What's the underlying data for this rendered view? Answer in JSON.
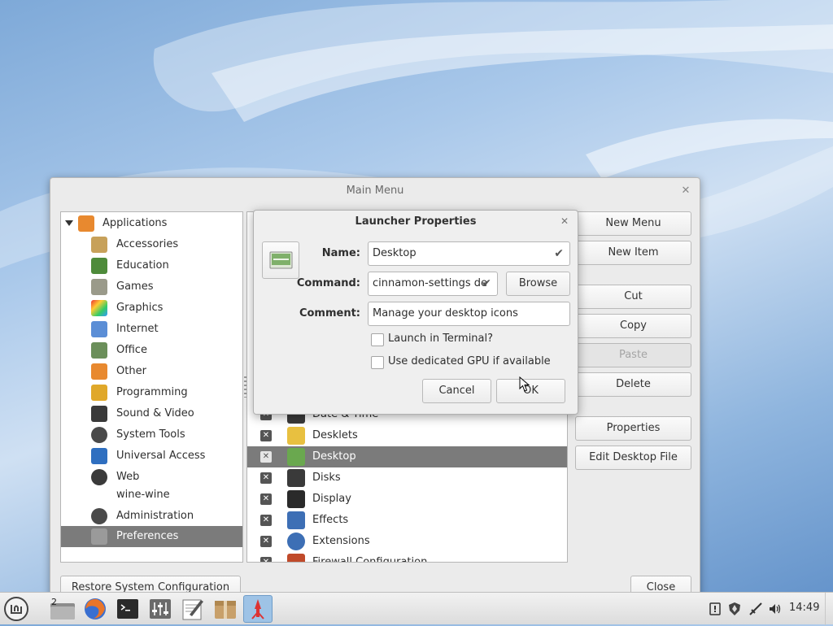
{
  "main_window": {
    "title": "Main Menu",
    "categories": {
      "root": "Applications",
      "items": [
        {
          "label": "Accessories",
          "color": "#c7a15a"
        },
        {
          "label": "Education",
          "color": "#4e8b3a"
        },
        {
          "label": "Games",
          "color": "#9a9a8a"
        },
        {
          "label": "Graphics",
          "color": "#d4477b"
        },
        {
          "label": "Internet",
          "color": "#5b8ed6"
        },
        {
          "label": "Office",
          "color": "#6b8f5a"
        },
        {
          "label": "Other",
          "color": "#e8892f"
        },
        {
          "label": "Programming",
          "color": "#e0a82a"
        },
        {
          "label": "Sound & Video",
          "color": "#3a3a3a"
        },
        {
          "label": "System Tools",
          "color": "#4a4a4a"
        },
        {
          "label": "Universal Access",
          "color": "#2f6fc0"
        },
        {
          "label": "Web",
          "color": "#3a3a3a"
        },
        {
          "label": "wine-wine",
          "color": ""
        },
        {
          "label": "Administration",
          "color": "#4a4a4a"
        },
        {
          "label": "Preferences",
          "color": "#7a7a7a"
        }
      ],
      "selected": "Preferences"
    },
    "items": [
      {
        "label": "Date & Time",
        "checked": true,
        "color": "#3a3a3a"
      },
      {
        "label": "Desklets",
        "checked": true,
        "color": "#e8c040"
      },
      {
        "label": "Desktop",
        "checked": true,
        "color": "#6aa84f"
      },
      {
        "label": "Disks",
        "checked": true,
        "color": "#3a3a3a"
      },
      {
        "label": "Display",
        "checked": true,
        "color": "#2a2a2a"
      },
      {
        "label": "Effects",
        "checked": true,
        "color": "#3d6fb5"
      },
      {
        "label": "Extensions",
        "checked": true,
        "color": "#3d6fb5"
      },
      {
        "label": "Firewall Configuration",
        "checked": true,
        "color": "#c04a2a"
      }
    ],
    "selected_item": "Desktop",
    "buttons": {
      "new_menu": "New Menu",
      "new_item": "New Item",
      "cut": "Cut",
      "copy": "Copy",
      "paste": "Paste",
      "delete": "Delete",
      "properties": "Properties",
      "edit_desktop_file": "Edit Desktop File",
      "restore": "Restore System Configuration",
      "close": "Close"
    }
  },
  "dialog": {
    "title": "Launcher Properties",
    "name_label": "Name:",
    "name_value": "Desktop",
    "command_label": "Command:",
    "command_value": "cinnamon-settings de",
    "browse": "Browse",
    "comment_label": "Comment:",
    "comment_value": "Manage your desktop icons",
    "launch_in_terminal": "Launch in Terminal?",
    "launch_in_terminal_checked": false,
    "dedicated_gpu": "Use dedicated GPU if available",
    "dedicated_gpu_checked": false,
    "cancel": "Cancel",
    "ok": "OK"
  },
  "taskbar": {
    "workspace_badge": "2",
    "clock": "14:49",
    "apps": [
      "files-icon",
      "firefox-icon",
      "terminal-icon",
      "mixer-icon",
      "text-editor-icon",
      "archive-icon",
      "menu-editor-icon"
    ]
  }
}
